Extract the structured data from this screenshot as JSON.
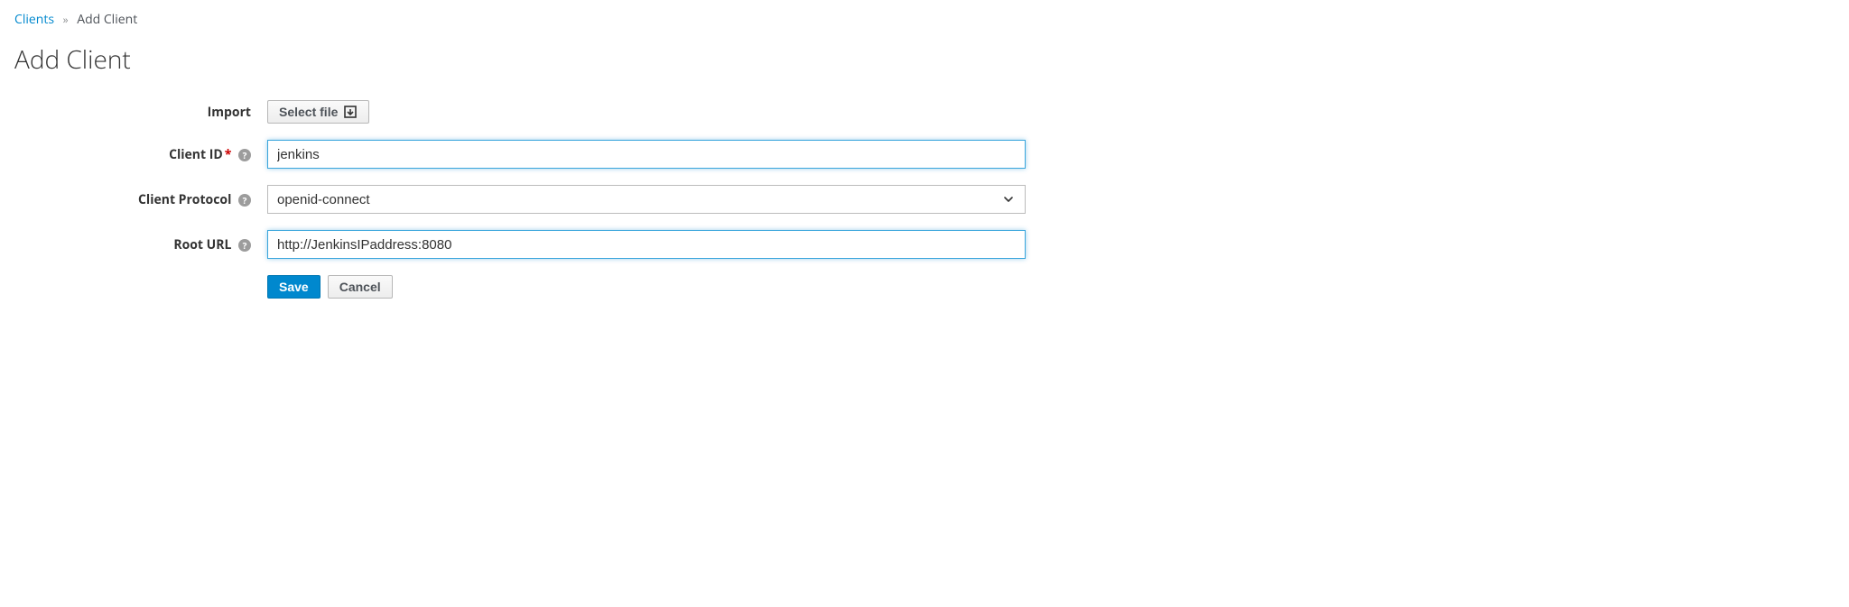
{
  "breadcrumb": {
    "parent": "Clients",
    "current": "Add Client"
  },
  "page": {
    "title": "Add Client"
  },
  "form": {
    "import": {
      "label": "Import",
      "button": "Select file"
    },
    "client_id": {
      "label": "Client ID",
      "value": "jenkins"
    },
    "client_protocol": {
      "label": "Client Protocol",
      "value": "openid-connect"
    },
    "root_url": {
      "label": "Root URL",
      "value": "http://JenkinsIPaddress:8080"
    }
  },
  "actions": {
    "save": "Save",
    "cancel": "Cancel"
  }
}
